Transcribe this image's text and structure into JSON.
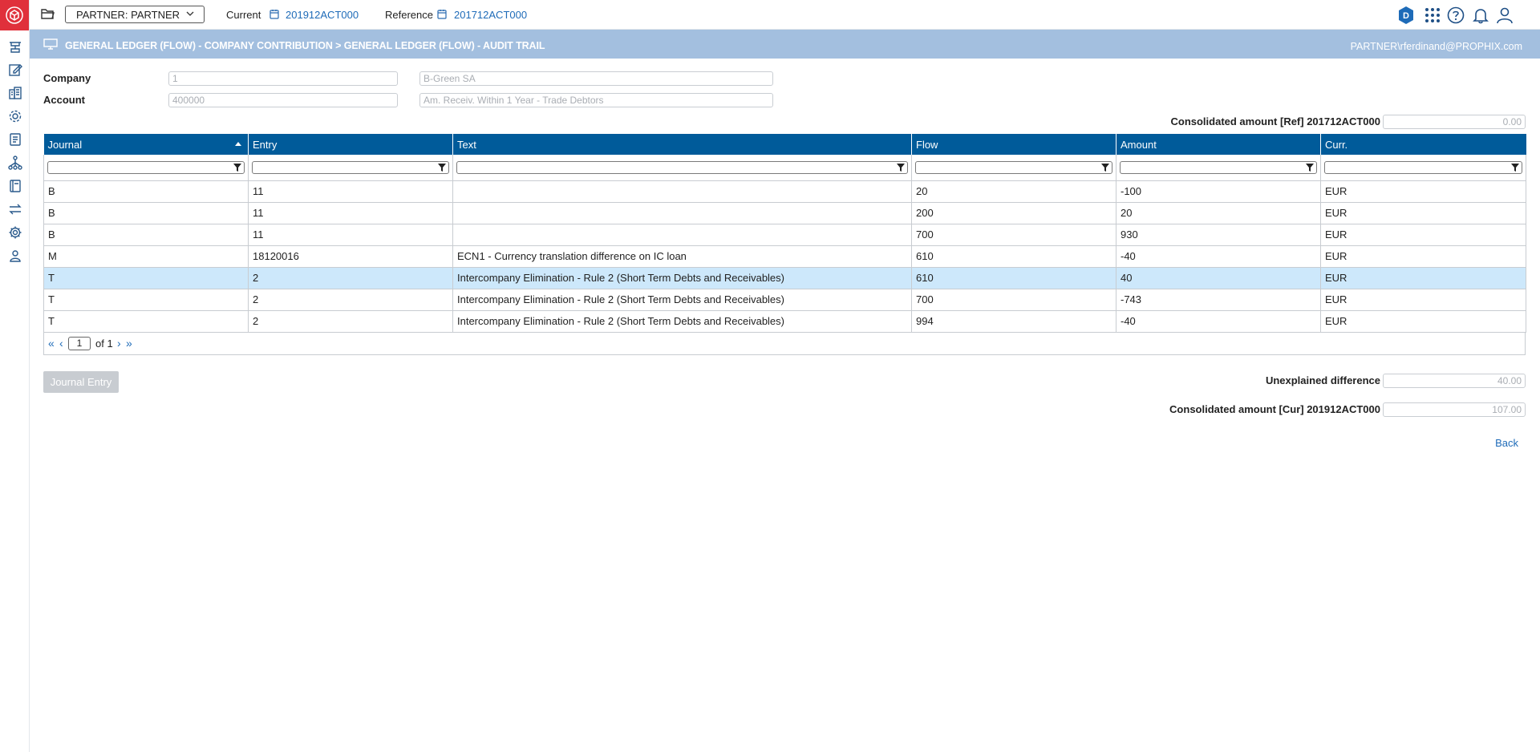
{
  "topbar": {
    "partner_select": "PARTNER: PARTNER",
    "current_label": "Current",
    "current_value": "201912ACT000",
    "reference_label": "Reference",
    "reference_value": "201712ACT000",
    "avatar_letter": "D"
  },
  "header": {
    "title": "GENERAL LEDGER (FLOW) - COMPANY CONTRIBUTION > GENERAL LEDGER (FLOW) - AUDIT TRAIL",
    "user": "PARTNER\\rferdinand@PROPHIX.com"
  },
  "form": {
    "company_label": "Company",
    "company_code": "1",
    "company_name": "B-Green SA",
    "account_label": "Account",
    "account_code": "400000",
    "account_name": "Am. Receiv. Within 1 Year - Trade Debtors",
    "consolidated_ref_label": "Consolidated amount [Ref] 201712ACT000",
    "consolidated_ref_value": "0.00",
    "unexplained_label": "Unexplained difference",
    "unexplained_value": "40.00",
    "consolidated_cur_label": "Consolidated amount [Cur] 201912ACT000",
    "consolidated_cur_value": "107.00"
  },
  "grid": {
    "columns": [
      "Journal",
      "Entry",
      "Text",
      "Flow",
      "Amount",
      "Curr."
    ],
    "rows": [
      [
        "B",
        "11",
        "",
        "20",
        "-100",
        "EUR"
      ],
      [
        "B",
        "11",
        "",
        "200",
        "20",
        "EUR"
      ],
      [
        "B",
        "11",
        "",
        "700",
        "930",
        "EUR"
      ],
      [
        "M",
        "18120016",
        "ECN1 - Currency translation difference on IC loan",
        "610",
        "-40",
        "EUR"
      ],
      [
        "T",
        "2",
        "Intercompany Elimination - Rule 2 (Short Term Debts and Receivables)",
        "610",
        "40",
        "EUR"
      ],
      [
        "T",
        "2",
        "Intercompany Elimination - Rule 2 (Short Term Debts and Receivables)",
        "700",
        "-743",
        "EUR"
      ],
      [
        "T",
        "2",
        "Intercompany Elimination - Rule 2 (Short Term Debts and Receivables)",
        "994",
        "-40",
        "EUR"
      ]
    ],
    "selected_row": 4
  },
  "pager": {
    "page": "1",
    "of_text": "of 1",
    "first": "«",
    "prev": "‹",
    "next": "›",
    "last": "»"
  },
  "actions": {
    "journal_entry": "Journal Entry",
    "back": "Back"
  },
  "colors": {
    "accent": "#005b9a",
    "header_band": "#a3bfdf",
    "logo": "#e0303b",
    "link": "#1e6bb8",
    "selected_row": "#cde8fb"
  }
}
